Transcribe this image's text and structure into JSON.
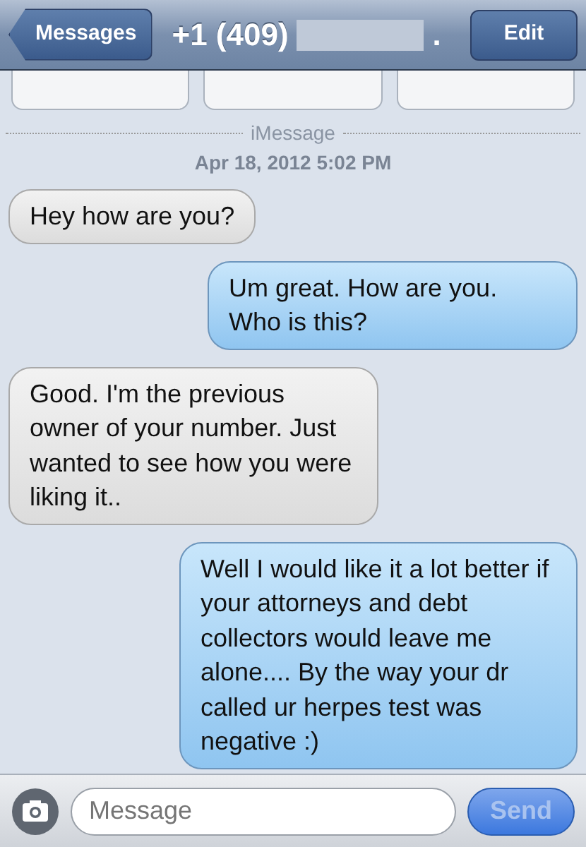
{
  "nav_bar": {
    "back_button": "Messages",
    "title": "+1 (409)",
    "title_end": ".",
    "edit_button": "Edit"
  },
  "service_label": "iMessage",
  "timestamp": "Apr 18, 2012 5:02 PM",
  "messages": [
    {
      "kind": "received",
      "text": "Hey how are you?"
    },
    {
      "kind": "sent",
      "text": "Um great. How are you. Who is this?"
    },
    {
      "kind": "received",
      "text": "Good. I'm the previous owner of your number. Just wanted to see how you were liking it.."
    },
    {
      "kind": "sent",
      "text": "Well I would like it a lot better if your attorneys and debt collectors would leave me alone.... By the way your dr called ur herpes test was negative :)"
    }
  ],
  "compose": {
    "placeholder": "Message",
    "send_button": "Send",
    "send_disabled": true
  }
}
